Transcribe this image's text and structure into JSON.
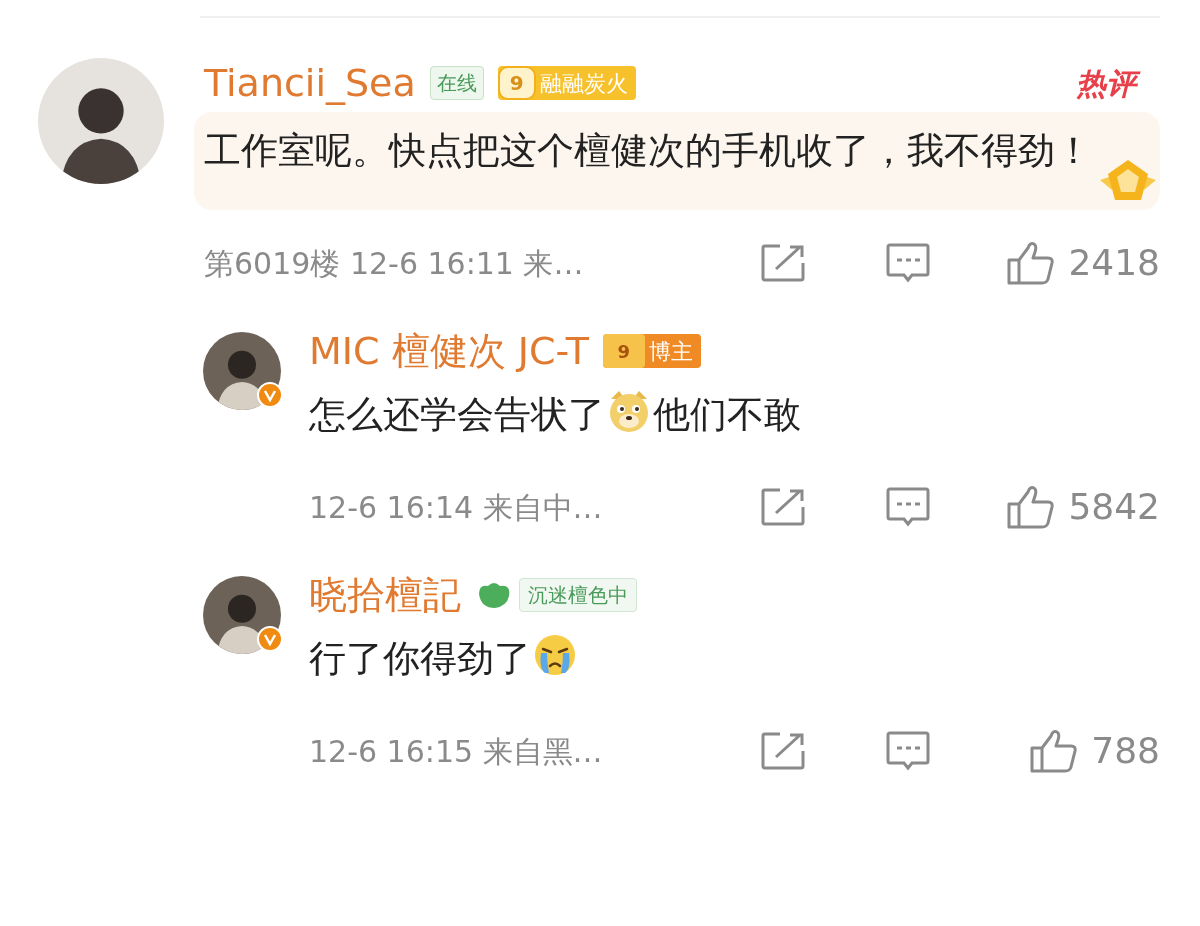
{
  "comments": [
    {
      "kind": "top",
      "verified": false,
      "name": "Tiancii_Sea",
      "hot_label": "热评",
      "highlight": true,
      "badges": [
        {
          "kind": "online",
          "text": "在线"
        },
        {
          "kind": "fan_level",
          "level_text": "9",
          "text": "融融炭火"
        }
      ],
      "content": [
        {
          "kind": "text",
          "text": "工作室呢。快点把这个檀健次的手机收了，我不得劲！"
        }
      ],
      "meta": "第6019楼 12-6 16:11 来…",
      "likes": "2418"
    },
    {
      "kind": "reply",
      "verified": true,
      "name": "MIC 檀健次 JC-T",
      "badges": [
        {
          "kind": "blogger",
          "level_text": "9",
          "text": "博主"
        }
      ],
      "content": [
        {
          "kind": "text",
          "text": "怎么还学会告状了"
        },
        {
          "kind": "doge"
        },
        {
          "kind": "text",
          "text": "他们不敢"
        }
      ],
      "meta": "12-6 16:14 来自中…",
      "likes": "5842"
    },
    {
      "kind": "reply",
      "verified": true,
      "name": "晓拾檀記",
      "badges": [
        {
          "kind": "fan_group",
          "text": "沉迷檀色中"
        }
      ],
      "content": [
        {
          "kind": "text",
          "text": "行了你得劲了"
        },
        {
          "kind": "crying"
        }
      ],
      "meta": "12-6 16:15 来自黑…",
      "likes": "788"
    }
  ]
}
